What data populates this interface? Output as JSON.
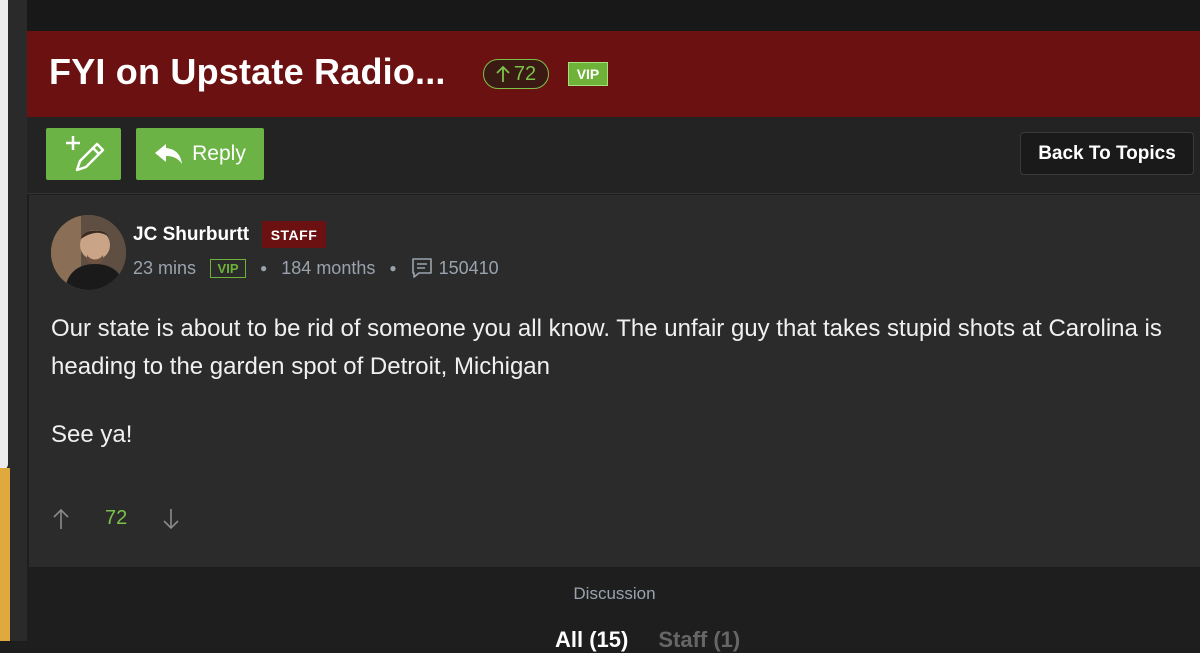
{
  "header": {
    "title": "FYI on Upstate Radio...",
    "vote_count": "72",
    "vip_badge": "VIP",
    "background": "#6b1111"
  },
  "toolbar": {
    "new_topic_icon": "pencil-plus-icon",
    "reply_label": "Reply",
    "reply_icon": "reply-arrow-icon",
    "back_label": "Back To Topics",
    "button_color": "#6ab344"
  },
  "post": {
    "author": "JC Shurburtt",
    "author_badge": "STAFF",
    "time_ago": "23 mins",
    "member_badge": "VIP",
    "tenure": "184 months",
    "post_count": "150410",
    "paragraphs": [
      "Our state is about to be rid of someone you all know. The unfair guy that takes stupid shots at Carolina is heading to the garden spot of Detroit, Michigan",
      "See ya!"
    ],
    "votes": "72"
  },
  "footer": {
    "discussion_label": "Discussion",
    "tab_all": "All (15)",
    "tab_staff": "Staff (1)"
  },
  "colors": {
    "accent_green": "#7cc24a",
    "staff_red": "#6b1111",
    "meta_gray": "#9aa3ad"
  }
}
